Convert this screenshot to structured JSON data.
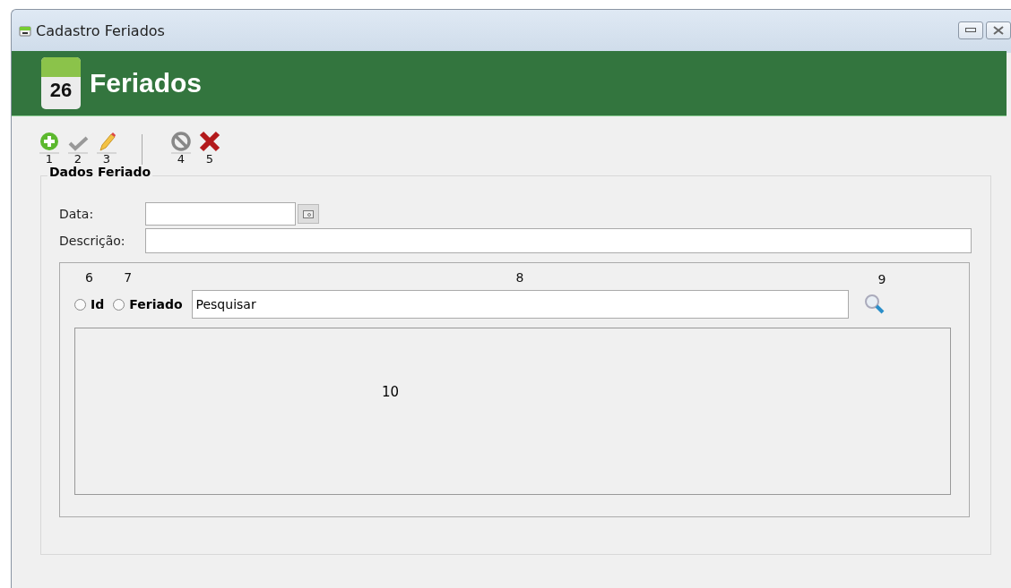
{
  "window": {
    "title": "Cadastro Feriados"
  },
  "header": {
    "day": "26",
    "title": "Feriados"
  },
  "toolbar": [
    {
      "kind": "add",
      "number": "1",
      "separator_before": false
    },
    {
      "kind": "confirm",
      "number": "2",
      "separator_before": false
    },
    {
      "kind": "edit",
      "number": "3",
      "separator_before": false
    },
    {
      "kind": "cancel",
      "number": "4",
      "separator_before": true
    },
    {
      "kind": "delete",
      "number": "5",
      "separator_before": false
    }
  ],
  "group": {
    "title": "Dados Feriado",
    "date_label": "Data:",
    "description_label": "Descrição:"
  },
  "search": {
    "radios": [
      {
        "label": "Id",
        "number": "6",
        "selected": false
      },
      {
        "label": "Feriado",
        "number": "7",
        "selected": false
      }
    ],
    "field_number": "8",
    "value": "Pesquisar",
    "button_number": "9",
    "results_number": "10"
  }
}
